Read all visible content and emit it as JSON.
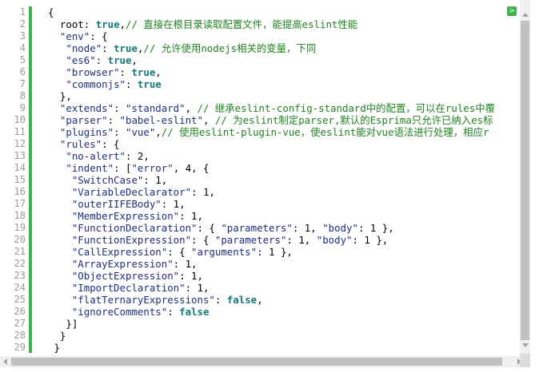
{
  "colors": {
    "gutter_bar": "#3cb54a",
    "line_number": "#999999",
    "string": "#1b2d9a",
    "keyword": "#0e7d7d",
    "comment": "#1a8a1a",
    "scrollbar_track": "#f0f0f0",
    "scrollbar_thumb": "#c1c1c1"
  },
  "expand_button": {
    "icon": "chevron-right-icon",
    "glyph": ">"
  },
  "line_numbers": [
    "1",
    "2",
    "3",
    "4",
    "5",
    "6",
    "7",
    "8",
    "9",
    "10",
    "11",
    "12",
    "13",
    "14",
    "15",
    "16",
    "17",
    "18",
    "19",
    "20",
    "21",
    "22",
    "23",
    "24",
    "25",
    "26",
    "27",
    "28",
    "29"
  ],
  "lines": [
    [
      {
        "t": "p",
        "v": "{"
      }
    ],
    [
      {
        "t": "p",
        "v": "  root: "
      },
      {
        "t": "kw",
        "v": "true"
      },
      {
        "t": "p",
        "v": ","
      },
      {
        "t": "c",
        "v": "// 直接在根目录读取配置文件，能提高eslint性能"
      }
    ],
    [
      {
        "t": "p",
        "v": "  "
      },
      {
        "t": "s",
        "v": "\"env\""
      },
      {
        "t": "p",
        "v": ": {"
      }
    ],
    [
      {
        "t": "p",
        "v": "   "
      },
      {
        "t": "s",
        "v": "\"node\""
      },
      {
        "t": "p",
        "v": ": "
      },
      {
        "t": "kw",
        "v": "true"
      },
      {
        "t": "p",
        "v": ","
      },
      {
        "t": "c",
        "v": "// 允许使用nodejs相关的变量，下同"
      }
    ],
    [
      {
        "t": "p",
        "v": "   "
      },
      {
        "t": "s",
        "v": "\"es6\""
      },
      {
        "t": "p",
        "v": ": "
      },
      {
        "t": "kw",
        "v": "true"
      },
      {
        "t": "p",
        "v": ","
      }
    ],
    [
      {
        "t": "p",
        "v": "   "
      },
      {
        "t": "s",
        "v": "\"browser\""
      },
      {
        "t": "p",
        "v": ": "
      },
      {
        "t": "kw",
        "v": "true"
      },
      {
        "t": "p",
        "v": ","
      }
    ],
    [
      {
        "t": "p",
        "v": "   "
      },
      {
        "t": "s",
        "v": "\"commonjs\""
      },
      {
        "t": "p",
        "v": ": "
      },
      {
        "t": "kw",
        "v": "true"
      }
    ],
    [
      {
        "t": "p",
        "v": "  },"
      }
    ],
    [
      {
        "t": "p",
        "v": "  "
      },
      {
        "t": "s",
        "v": "\"extends\""
      },
      {
        "t": "p",
        "v": ": "
      },
      {
        "t": "s",
        "v": "\"standard\""
      },
      {
        "t": "p",
        "v": ", "
      },
      {
        "t": "c",
        "v": "// 继承eslint-config-standard中的配置，可以在rules中覆"
      }
    ],
    [
      {
        "t": "p",
        "v": "  "
      },
      {
        "t": "s",
        "v": "\"parser\""
      },
      {
        "t": "p",
        "v": ": "
      },
      {
        "t": "s",
        "v": "\"babel-eslint\""
      },
      {
        "t": "p",
        "v": ", "
      },
      {
        "t": "c",
        "v": "// 为eslint制定parser,默认的Esprima只允许已纳入es标"
      }
    ],
    [
      {
        "t": "p",
        "v": "  "
      },
      {
        "t": "s",
        "v": "\"plugins\""
      },
      {
        "t": "p",
        "v": ": "
      },
      {
        "t": "s",
        "v": "\"vue\""
      },
      {
        "t": "p",
        "v": ","
      },
      {
        "t": "c",
        "v": "// 使用eslint-plugin-vue，使eslint能对vue语法进行处理，相应r"
      }
    ],
    [
      {
        "t": "p",
        "v": "  "
      },
      {
        "t": "s",
        "v": "\"rules\""
      },
      {
        "t": "p",
        "v": ": {"
      }
    ],
    [
      {
        "t": "p",
        "v": "   "
      },
      {
        "t": "s",
        "v": "\"no-alert\""
      },
      {
        "t": "p",
        "v": ": 2,"
      }
    ],
    [
      {
        "t": "p",
        "v": "   "
      },
      {
        "t": "s",
        "v": "\"indent\""
      },
      {
        "t": "p",
        "v": ": ["
      },
      {
        "t": "s",
        "v": "\"error\""
      },
      {
        "t": "p",
        "v": ", 4, {"
      }
    ],
    [
      {
        "t": "p",
        "v": "    "
      },
      {
        "t": "s",
        "v": "\"SwitchCase\""
      },
      {
        "t": "p",
        "v": ": 1,"
      }
    ],
    [
      {
        "t": "p",
        "v": "    "
      },
      {
        "t": "s",
        "v": "\"VariableDeclarator\""
      },
      {
        "t": "p",
        "v": ": 1,"
      }
    ],
    [
      {
        "t": "p",
        "v": "    "
      },
      {
        "t": "s",
        "v": "\"outerIIFEBody\""
      },
      {
        "t": "p",
        "v": ": 1,"
      }
    ],
    [
      {
        "t": "p",
        "v": "    "
      },
      {
        "t": "s",
        "v": "\"MemberExpression\""
      },
      {
        "t": "p",
        "v": ": 1,"
      }
    ],
    [
      {
        "t": "p",
        "v": "    "
      },
      {
        "t": "s",
        "v": "\"FunctionDeclaration\""
      },
      {
        "t": "p",
        "v": ": { "
      },
      {
        "t": "s",
        "v": "\"parameters\""
      },
      {
        "t": "p",
        "v": ": 1, "
      },
      {
        "t": "s",
        "v": "\"body\""
      },
      {
        "t": "p",
        "v": ": 1 },"
      }
    ],
    [
      {
        "t": "p",
        "v": "    "
      },
      {
        "t": "s",
        "v": "\"FunctionExpression\""
      },
      {
        "t": "p",
        "v": ": { "
      },
      {
        "t": "s",
        "v": "\"parameters\""
      },
      {
        "t": "p",
        "v": ": 1, "
      },
      {
        "t": "s",
        "v": "\"body\""
      },
      {
        "t": "p",
        "v": ": 1 },"
      }
    ],
    [
      {
        "t": "p",
        "v": "    "
      },
      {
        "t": "s",
        "v": "\"CallExpression\""
      },
      {
        "t": "p",
        "v": ": { "
      },
      {
        "t": "s",
        "v": "\"arguments\""
      },
      {
        "t": "p",
        "v": ": 1 },"
      }
    ],
    [
      {
        "t": "p",
        "v": "    "
      },
      {
        "t": "s",
        "v": "\"ArrayExpression\""
      },
      {
        "t": "p",
        "v": ": 1,"
      }
    ],
    [
      {
        "t": "p",
        "v": "    "
      },
      {
        "t": "s",
        "v": "\"ObjectExpression\""
      },
      {
        "t": "p",
        "v": ": 1,"
      }
    ],
    [
      {
        "t": "p",
        "v": "    "
      },
      {
        "t": "s",
        "v": "\"ImportDeclaration\""
      },
      {
        "t": "p",
        "v": ": 1,"
      }
    ],
    [
      {
        "t": "p",
        "v": "    "
      },
      {
        "t": "s",
        "v": "\"flatTernaryExpressions\""
      },
      {
        "t": "p",
        "v": ": "
      },
      {
        "t": "kw",
        "v": "false"
      },
      {
        "t": "p",
        "v": ","
      }
    ],
    [
      {
        "t": "p",
        "v": "    "
      },
      {
        "t": "s",
        "v": "\"ignoreComments\""
      },
      {
        "t": "p",
        "v": ": "
      },
      {
        "t": "kw",
        "v": "false"
      }
    ],
    [
      {
        "t": "p",
        "v": "   }]"
      }
    ],
    [
      {
        "t": "p",
        "v": "  }"
      }
    ],
    [
      {
        "t": "p",
        "v": " }"
      }
    ]
  ]
}
